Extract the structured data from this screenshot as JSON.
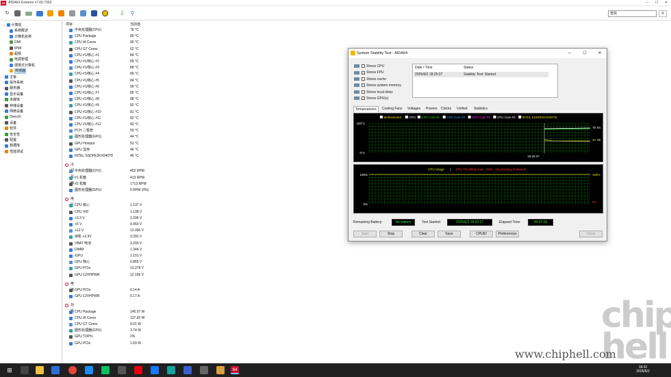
{
  "window": {
    "title": "AIDA64 Extreme v7.60.7300",
    "app_icon_text": "64"
  },
  "toolbar": {
    "search_value": "查找"
  },
  "tree": [
    {
      "label": "计算机",
      "indent": 0,
      "color": "#3a7bd5"
    },
    {
      "label": "系统概述",
      "indent": 1,
      "color": "#3a7bd5"
    },
    {
      "label": "计算机名称",
      "indent": 1,
      "color": "#3a7bd5"
    },
    {
      "label": "DMI",
      "indent": 1,
      "color": "#4a9a4a"
    },
    {
      "label": "IPMI",
      "indent": 1,
      "color": "#555"
    },
    {
      "label": "超频",
      "indent": 1,
      "color": "#e08a00"
    },
    {
      "label": "电源管理",
      "indent": 1,
      "color": "#3a9a3a"
    },
    {
      "label": "便携式计算机",
      "indent": 1,
      "color": "#3a7bd5"
    },
    {
      "label": "传感器",
      "indent": 1,
      "color": "#f0a000",
      "selected": true
    },
    {
      "label": "主板",
      "indent": 0,
      "color": "#3a7bd5"
    },
    {
      "label": "操作系统",
      "indent": 0,
      "color": "#3a7bd5"
    },
    {
      "label": "服务器",
      "indent": 0,
      "color": "#555"
    },
    {
      "label": "显示设备",
      "indent": 0,
      "color": "#3a7bd5"
    },
    {
      "label": "多媒体",
      "indent": 0,
      "color": "#3a9a3a"
    },
    {
      "label": "存储设备",
      "indent": 0,
      "color": "#555"
    },
    {
      "label": "网络设备",
      "indent": 0,
      "color": "#3a7bd5"
    },
    {
      "label": "DirectX",
      "indent": 0,
      "color": "#3a9a3a"
    },
    {
      "label": "设备",
      "indent": 0,
      "color": "#555"
    },
    {
      "label": "软件",
      "indent": 0,
      "color": "#e08a00"
    },
    {
      "label": "安全性",
      "indent": 0,
      "color": "#3a9a3a"
    },
    {
      "label": "配置",
      "indent": 0,
      "color": "#555"
    },
    {
      "label": "数据库",
      "indent": 0,
      "color": "#3a7bd5"
    },
    {
      "label": "性能测试",
      "indent": 0,
      "color": "#e08a00"
    }
  ],
  "list_headers": {
    "item": "项目",
    "value": "当前值"
  },
  "sections": [
    {
      "title": null,
      "rows": [
        {
          "name": "中央处理器(CPU)",
          "value": "78 °C"
        },
        {
          "name": "CPU Package",
          "value": "89 °C"
        },
        {
          "name": "CPU IA Cores",
          "value": "90 °C"
        },
        {
          "name": "CPU GT Cores",
          "value": "62 °C"
        },
        {
          "name": "CPU #1/核心 #1",
          "value": "84 °C"
        },
        {
          "name": "CPU #1/核心 #2",
          "value": "89 °C"
        },
        {
          "name": "CPU #1/核心 #3",
          "value": "88 °C"
        },
        {
          "name": "CPU #1/核心 #4",
          "value": "89 °C"
        },
        {
          "name": "CPU #1/核心 #5",
          "value": "84 °C"
        },
        {
          "name": "CPU #1/核心 #6",
          "value": "90 °C"
        },
        {
          "name": "CPU #1/核心 #7",
          "value": "85 °C"
        },
        {
          "name": "CPU #1/核心 #8",
          "value": "88 °C"
        },
        {
          "name": "CPU #1/核心 #9",
          "value": "82 °C"
        },
        {
          "name": "CPU #1/核心 #10",
          "value": "81 °C"
        },
        {
          "name": "CPU #1/核心 #11",
          "value": "82 °C"
        },
        {
          "name": "CPU #1/核心 #12",
          "value": "82 °C"
        },
        {
          "name": "PCH 二极管",
          "value": "59 °C"
        },
        {
          "name": "图形处理器(GPU)",
          "value": "44 °C"
        },
        {
          "name": "GPU Hotspot",
          "value": "53 °C"
        },
        {
          "name": "GPU 显存",
          "value": "46 °C"
        },
        {
          "name": "INTEL SSDPE2KX040T8",
          "value": "46 °C"
        }
      ]
    },
    {
      "title": "冷却风扇",
      "rows": [
        {
          "name": "中央处理器(CPU)",
          "value": "452 RPM"
        },
        {
          "name": "#1 机箱",
          "value": "413 RPM"
        },
        {
          "name": "#2 机箱",
          "value": "1713 RPM"
        },
        {
          "name": "图形处理器(GPU)",
          "value": "0 RPM  (0%)"
        }
      ]
    },
    {
      "title": "电压",
      "rows": [
        {
          "name": "CPU 核心",
          "value": "1.137 V"
        },
        {
          "name": "CPU VID",
          "value": "1.108 V"
        },
        {
          "name": "+3.3 V",
          "value": "3.296 V"
        },
        {
          "name": "+5 V",
          "value": "4.960 V"
        },
        {
          "name": "+12 V",
          "value": "12.000 V"
        },
        {
          "name": "待机 +3.3V",
          "value": "3.392 V"
        },
        {
          "name": "VBAT 电池",
          "value": "3.200 V"
        },
        {
          "name": "DIMM",
          "value": "1.344 V"
        },
        {
          "name": "iGPU",
          "value": "1.101 V"
        },
        {
          "name": "GPU 核心",
          "value": "0.865 V"
        },
        {
          "name": "GPU PCIe",
          "value": "12.278 V"
        },
        {
          "name": "GPU 12VHPWR",
          "value": "12.196 V"
        }
      ]
    },
    {
      "title": "电流",
      "rows": [
        {
          "name": "GPU PCIe",
          "value": "0.14 A"
        },
        {
          "name": "GPU 12VHPWR",
          "value": "0.17 A"
        }
      ]
    },
    {
      "title": "功耗",
      "rows": [
        {
          "name": "CPU Package",
          "value": "145.07 W"
        },
        {
          "name": "CPU IA Cores",
          "value": "137.82 W"
        },
        {
          "name": "CPU GT Cores",
          "value": "0.01 W"
        },
        {
          "name": "图形处理器(GPU)",
          "value": "3.74 W"
        },
        {
          "name": "GPU TDP%",
          "value": "2%"
        },
        {
          "name": "GPU PCIe",
          "value": "1.69 W"
        }
      ]
    }
  ],
  "dialog": {
    "title": "System Stability Test - AIDA64",
    "stress_options": [
      {
        "label": "Stress CPU",
        "checked": false
      },
      {
        "label": "Stress FPU",
        "checked": true
      },
      {
        "label": "Stress cache",
        "checked": false
      },
      {
        "label": "Stress system memory",
        "checked": false
      },
      {
        "label": "Stress local disks",
        "checked": false
      },
      {
        "label": "Stress GPU(s)",
        "checked": false
      }
    ],
    "log_headers": {
      "date": "Date / Time",
      "status": "Status"
    },
    "log_row": {
      "date": "2025/6/2 18:25:27",
      "status": "Stability Test: Started"
    },
    "tabs": [
      "Temperatures",
      "Cooling Fans",
      "Voltages",
      "Powers",
      "Clocks",
      "Unified",
      "Statistics"
    ],
    "graph1": {
      "legend": [
        {
          "label": "Motherboard",
          "color": "#e0e000"
        },
        {
          "label": "CPU",
          "color": "#ffffff"
        },
        {
          "label": "CPU Core #1",
          "color": "#33dd33"
        },
        {
          "label": "CPU Core #2",
          "color": "#33aaff"
        },
        {
          "label": "CPU Core #3",
          "color": "#ff33ff"
        },
        {
          "label": "CPU Core #4",
          "color": "#ffffff"
        },
        {
          "label": "INTEL SSDPE2KX040T8",
          "color": "#e0e000"
        }
      ],
      "y_top": "100°C",
      "y_bottom": "0°C",
      "time": "18:25:27",
      "val_top": "78",
      "val_top2": "84",
      "val_low": "42",
      "val_low2": "46"
    },
    "graph2": {
      "title_a": "CPU Usage",
      "sep": "|",
      "title_b": "CPU Throttling (max: 19%) - Overheating Detected!",
      "y_top": "100%",
      "y_bottom": "0%",
      "right_top": "100%",
      "right_bottom": "0%"
    },
    "remaining_battery_label": "Remaining Battery:",
    "remaining_battery_value": "No battery",
    "test_started_label": "Test Started:",
    "test_started_value": "2025/6/2 18:25:27",
    "elapsed_label": "Elapsed Time:",
    "elapsed_value": "00:07:00",
    "buttons": {
      "start": "Start",
      "stop": "Stop",
      "clear": "Clear",
      "save": "Save",
      "cpuid": "CPUID",
      "preferences": "Preferences",
      "close": "Close"
    }
  },
  "taskbar": {
    "time": "18:32",
    "date": "2025/6/2",
    "active_app": "64"
  },
  "watermark": {
    "site": "www.chiphell.com",
    "logo": "chip hell"
  }
}
